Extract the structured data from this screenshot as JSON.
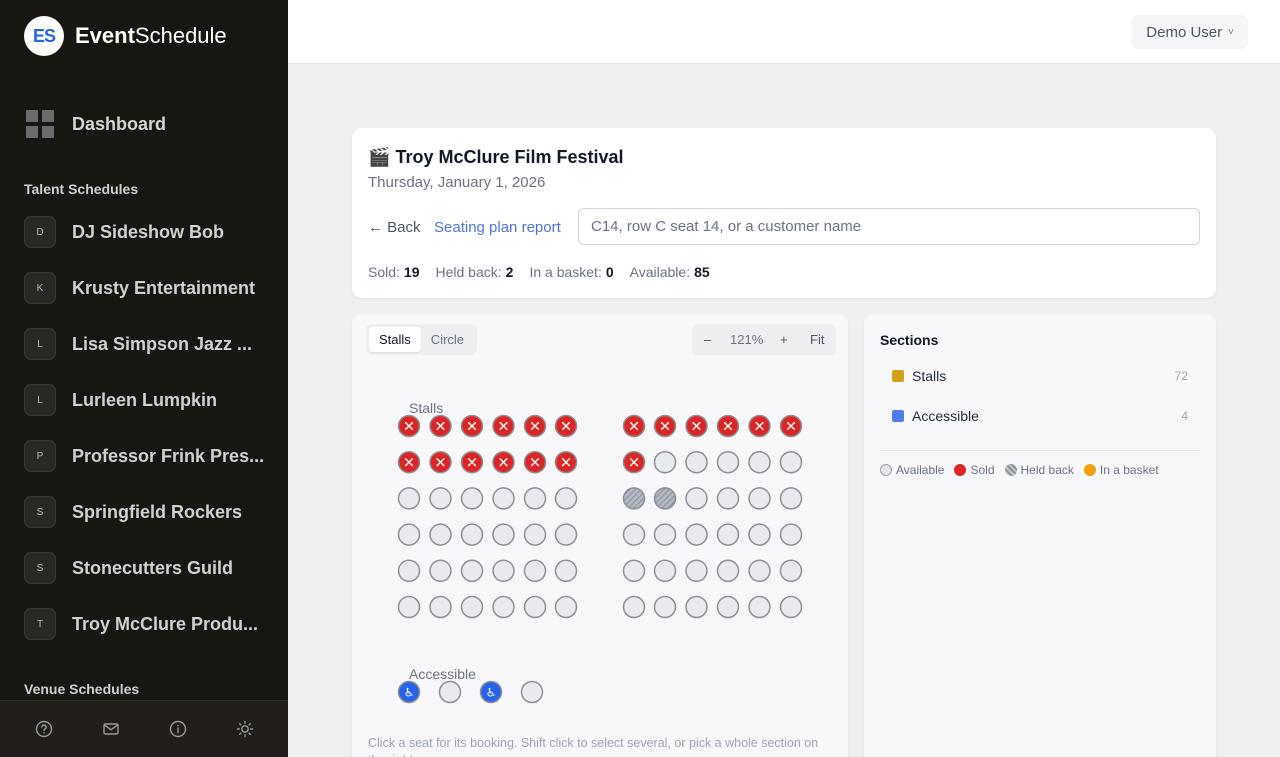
{
  "brand": {
    "logo_text": "ES",
    "name_bold": "Event",
    "name_rest": "Schedule"
  },
  "sidebar": {
    "dashboard_label": "Dashboard",
    "talent_title": "Talent Schedules",
    "talent": [
      {
        "initial": "D",
        "label": "DJ Sideshow Bob"
      },
      {
        "initial": "K",
        "label": "Krusty Entertainment"
      },
      {
        "initial": "L",
        "label": "Lisa Simpson Jazz ..."
      },
      {
        "initial": "L",
        "label": "Lurleen Lumpkin"
      },
      {
        "initial": "P",
        "label": "Professor Frink Pres..."
      },
      {
        "initial": "S",
        "label": "Springfield Rockers"
      },
      {
        "initial": "S",
        "label": "Stonecutters Guild"
      },
      {
        "initial": "T",
        "label": "Troy McClure Produ..."
      }
    ],
    "venue_title": "Venue Schedules",
    "footer_icons": [
      "help-icon",
      "mail-icon",
      "info-icon",
      "sun-icon"
    ]
  },
  "topbar": {
    "user_label": "Demo User",
    "chevron": "˅"
  },
  "event": {
    "emoji": "🎬",
    "title": "Troy McClure Film Festival",
    "date": "Thursday, January 1, 2026",
    "back_label": "← Back",
    "report_label": "Seating plan report",
    "search_placeholder": "C14, row C seat 14, or a customer name",
    "stats": [
      {
        "label": "Sold:",
        "value": "19"
      },
      {
        "label": "Held back:",
        "value": "2"
      },
      {
        "label": "In a basket:",
        "value": "0"
      },
      {
        "label": "Available:",
        "value": "85"
      }
    ]
  },
  "seating": {
    "tabs": [
      {
        "label": "Stalls",
        "active": true
      },
      {
        "label": "Circle",
        "active": false
      }
    ],
    "zoom": {
      "minus": "–",
      "value": "121%",
      "plus": "+",
      "fit": "Fit"
    },
    "stalls_label": "Stalls",
    "accessible_label": "Accessible",
    "stalls_rows": [
      [
        "sold",
        "sold",
        "sold",
        "sold",
        "sold",
        "sold",
        "sold",
        "sold",
        "sold",
        "sold",
        "sold",
        "sold"
      ],
      [
        "sold",
        "sold",
        "sold",
        "sold",
        "sold",
        "sold",
        "sold",
        "available",
        "available",
        "available",
        "available",
        "available"
      ],
      [
        "available",
        "available",
        "available",
        "available",
        "available",
        "available",
        "held",
        "held",
        "available",
        "available",
        "available",
        "available"
      ],
      [
        "available",
        "available",
        "available",
        "available",
        "available",
        "available",
        "available",
        "available",
        "available",
        "available",
        "available",
        "available"
      ],
      [
        "available",
        "available",
        "available",
        "available",
        "available",
        "available",
        "available",
        "available",
        "available",
        "available",
        "available",
        "available"
      ],
      [
        "available",
        "available",
        "available",
        "available",
        "available",
        "available",
        "available",
        "available",
        "available",
        "available",
        "available",
        "available"
      ]
    ],
    "accessible_seats": [
      "accessible-sold",
      "available",
      "accessible-sold",
      "available"
    ],
    "help_text": "Click a seat for its booking. Shift click to select several, or pick a whole section on the right.",
    "colors": {
      "available_fill": "#e9eaee",
      "available_stroke": "#8b8f98",
      "sold_fill": "#dc2626",
      "held_fill": "#a3a7b0",
      "accessible_fill": "#2563eb"
    }
  },
  "sections": {
    "title": "Sections",
    "items": [
      {
        "name": "Stalls",
        "count": "72",
        "color": "#d4a017"
      },
      {
        "name": "Accessible",
        "count": "4",
        "color": "#4f7fea"
      }
    ],
    "legend": [
      {
        "label": "Available",
        "color": "#e5e7eb"
      },
      {
        "label": "Sold",
        "color": "#dc2626"
      },
      {
        "label": "Held back",
        "color": "#9ca3af"
      },
      {
        "label": "In a basket",
        "color": "#f59e0b"
      }
    ]
  }
}
